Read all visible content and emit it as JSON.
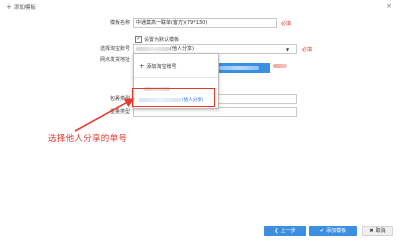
{
  "dialog": {
    "title": "添加模板",
    "close_icon": "×"
  },
  "form": {
    "template_name_label": "模板名称",
    "template_name_value": "中通莫高一联单(客方)(79*130)",
    "required_text": "必填",
    "set_default_label": "设置为默认模板",
    "set_default_checked": true,
    "taobao_account_label": "选择淘宝账号",
    "taobao_account_value": "(他人分享)",
    "taobao_required_text": "必填",
    "sender_address_label": "网点发货地址",
    "package_type_label": "包裹类型",
    "package_weight_label": "重量类型"
  },
  "dropdown": {
    "add_account_label": "添加淘宝账号",
    "item_suffix": "(他人分享)",
    "selected_index": 1
  },
  "annotation": {
    "text": "选择他人分享的单号",
    "color": "#e53b2e"
  },
  "footer": {
    "prev_label": "上一步",
    "add_label": "添加模板",
    "cancel_label": "取消"
  },
  "colors": {
    "accent": "#3c8ee0",
    "danger": "#e53b2e"
  }
}
